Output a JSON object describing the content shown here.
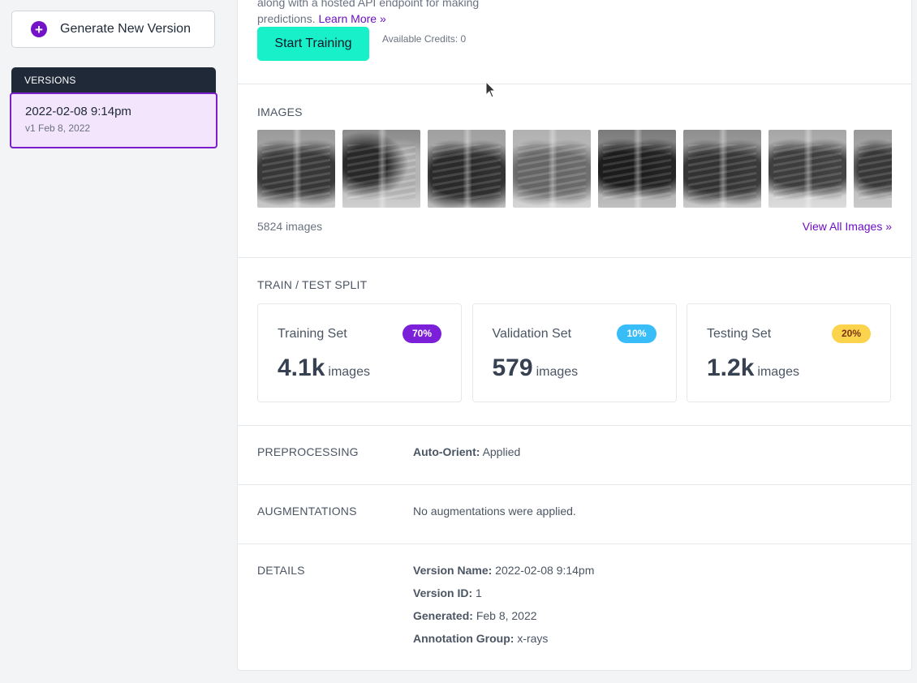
{
  "sidebar": {
    "generate_label": "Generate New Version",
    "versions_heading": "VERSIONS",
    "version_item": {
      "title": "2022-02-08 9:14pm",
      "subtitle": "v1 Feb 8, 2022"
    }
  },
  "intro": {
    "text_line1": "along with a hosted API endpoint for making",
    "text_line2": "predictions.",
    "learn_more": "Learn More »",
    "start_training": "Start Training",
    "credits": "Available Credits: 0"
  },
  "images": {
    "heading": "IMAGES",
    "count": "5824 images",
    "view_all": "View All Images »"
  },
  "split": {
    "heading": "TRAIN / TEST SPLIT",
    "cards": [
      {
        "title": "Training Set",
        "badge": "70%",
        "count": "4.1k",
        "unit": "images",
        "badge_bg": "#7c1fd9",
        "badge_fg": "#ffffff"
      },
      {
        "title": "Validation Set",
        "badge": "10%",
        "count": "579",
        "unit": "images",
        "badge_bg": "#38bdf8",
        "badge_fg": "#ffffff"
      },
      {
        "title": "Testing Set",
        "badge": "20%",
        "count": "1.2k",
        "unit": "images",
        "badge_bg": "#fcd34d",
        "badge_fg": "#78350f"
      }
    ]
  },
  "preprocessing": {
    "heading": "PREPROCESSING",
    "key": "Auto-Orient:",
    "value": "Applied"
  },
  "augmentations": {
    "heading": "AUGMENTATIONS",
    "value": "No augmentations were applied."
  },
  "details": {
    "heading": "DETAILS",
    "rows": [
      {
        "key": "Version Name:",
        "value": "2022-02-08 9:14pm"
      },
      {
        "key": "Version ID:",
        "value": "1"
      },
      {
        "key": "Generated:",
        "value": "Feb 8, 2022"
      },
      {
        "key": "Annotation Group:",
        "value": "x-rays"
      }
    ]
  },
  "colors": {
    "accent": "#6d0fc2",
    "primary_button": "#17f0c8",
    "sidebar_header": "#1f2937"
  }
}
